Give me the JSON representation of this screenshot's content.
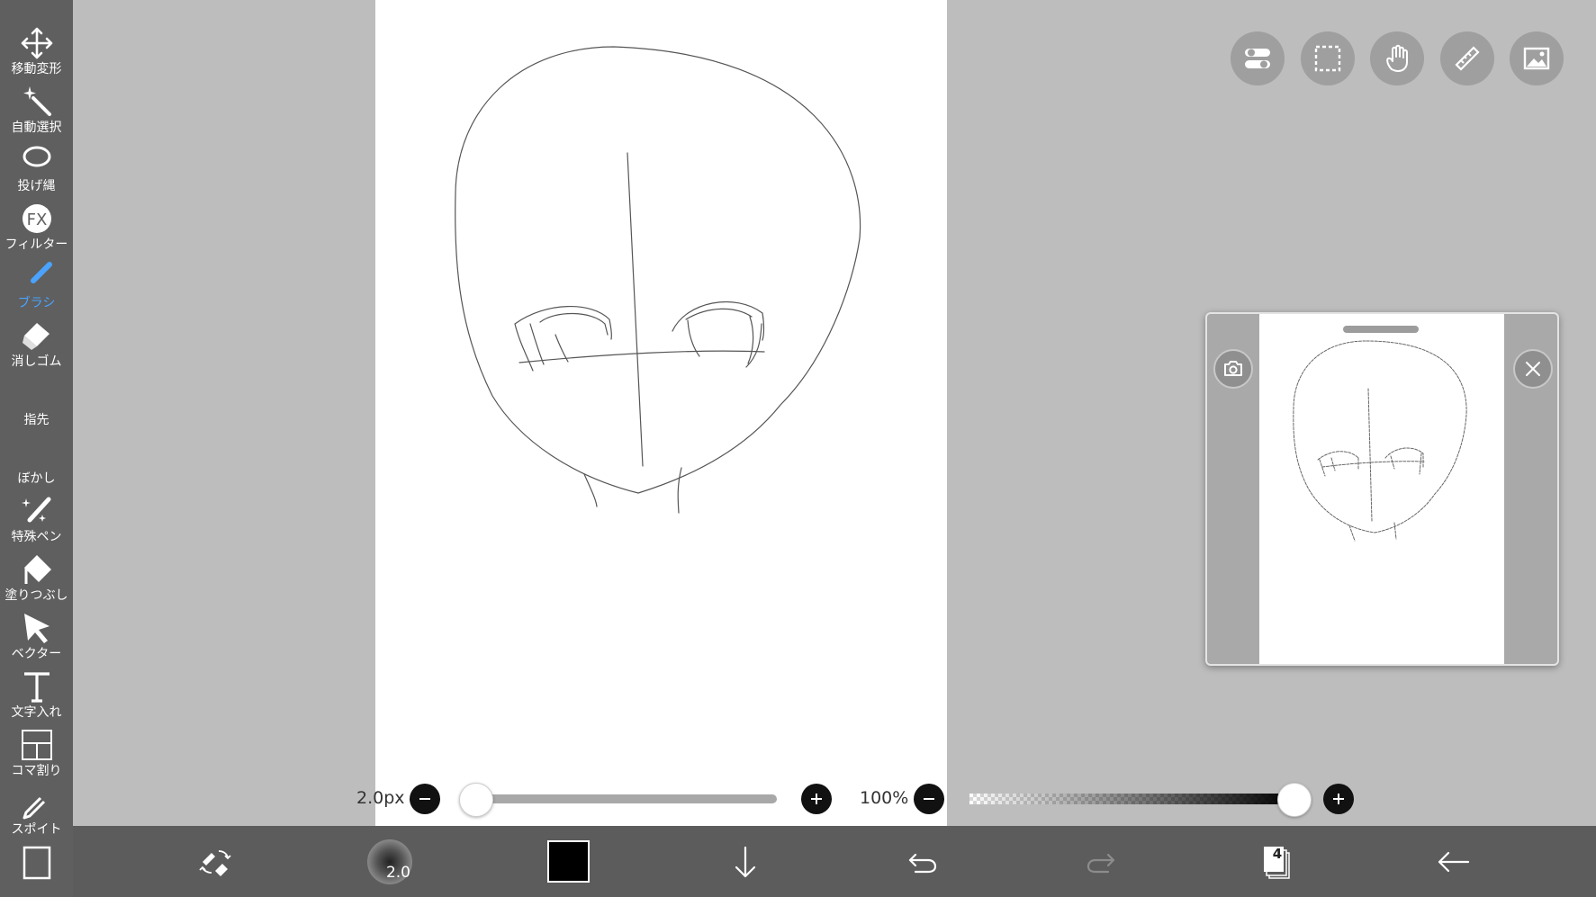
{
  "toolbar": {
    "active_index": 4,
    "active_color": "#4aa3ff",
    "tools": [
      {
        "label": "移動変形",
        "icon": "move-arrows-icon"
      },
      {
        "label": "自動選択",
        "icon": "magic-wand-icon"
      },
      {
        "label": "投げ縄",
        "icon": "lasso-icon"
      },
      {
        "label": "フィルター",
        "icon": "fx-icon"
      },
      {
        "label": "ブラシ",
        "icon": "brush-icon"
      },
      {
        "label": "消しゴム",
        "icon": "eraser-icon"
      },
      {
        "label": "指先",
        "icon": "finger-smudge-icon"
      },
      {
        "label": "ぼかし",
        "icon": "blur-drop-icon"
      },
      {
        "label": "特殊ペン",
        "icon": "special-pen-icon"
      },
      {
        "label": "塗りつぶし",
        "icon": "fill-bucket-icon"
      },
      {
        "label": "ベクター",
        "icon": "vector-arrow-icon"
      },
      {
        "label": "文字入れ",
        "icon": "text-icon"
      },
      {
        "label": "コマ割り",
        "icon": "panel-divide-icon"
      },
      {
        "label": "スポイト",
        "icon": "eyedropper-icon"
      }
    ]
  },
  "top_buttons": [
    {
      "icon": "toggle-settings-icon"
    },
    {
      "icon": "selection-marquee-icon"
    },
    {
      "icon": "hand-pan-icon"
    },
    {
      "icon": "ruler-icon"
    },
    {
      "icon": "image-material-icon"
    }
  ],
  "navigator": {
    "camera_icon": "camera-icon",
    "close_icon": "close-icon"
  },
  "brush_size": {
    "label": "2.0px",
    "value_fraction": 0.0
  },
  "opacity": {
    "label": "100%",
    "value_fraction": 1.0
  },
  "bottom_bar": {
    "brush_preview_text": "2.0",
    "current_color": "#000000",
    "layer_count": "4",
    "icons": [
      "swap-pen-eraser-icon",
      "brush-preview-icon",
      "color-swatch",
      "move-down-icon",
      "undo-icon",
      "redo-icon",
      "layers-icon",
      "back-arrow-icon"
    ]
  }
}
